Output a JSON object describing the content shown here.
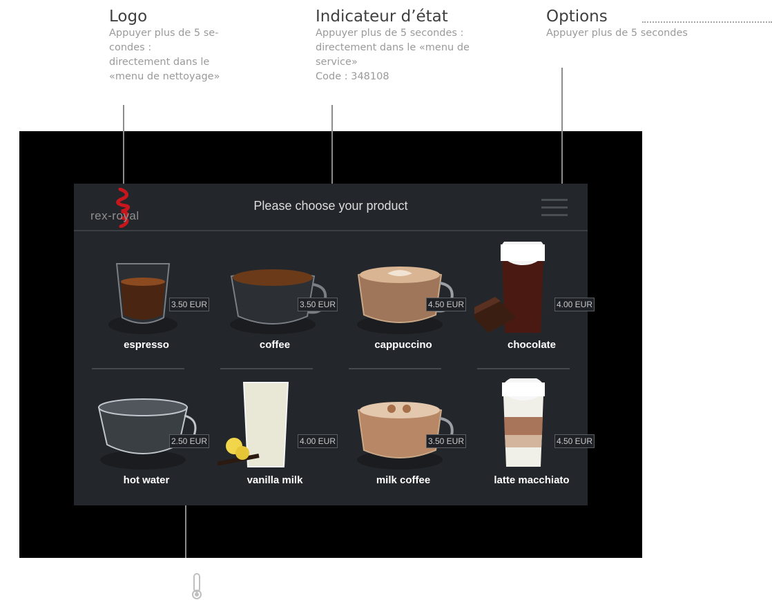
{
  "annotations": {
    "logo": {
      "title": "Logo",
      "body": "Appuyer plus de 5 se-\ncondes :\ndirectement dans le\n«menu de nettoyage»"
    },
    "status": {
      "title": "Indicateur d’état",
      "body": "Appuyer plus de 5 secondes :\ndirectement dans le «menu de\nservice»\nCode : 348108"
    },
    "options": {
      "title": "Options",
      "body": "Appuyer plus de 5 secondes"
    }
  },
  "header": {
    "logo_text": "rex-royal",
    "title": "Please choose your product",
    "menu_icon": "hamburger-menu-icon"
  },
  "products": [
    {
      "name": "espresso",
      "price": "3.50 EUR",
      "image": "espresso-cup-icon"
    },
    {
      "name": "coffee",
      "price": "3.50 EUR",
      "image": "coffee-cup-icon"
    },
    {
      "name": "cappuccino",
      "price": "4.50 EUR",
      "image": "cappuccino-cup-icon"
    },
    {
      "name": "chocolate",
      "price": "4.00 EUR",
      "image": "chocolate-glass-icon"
    },
    {
      "name": "hot water",
      "price": "2.50 EUR",
      "image": "hot-water-bowl-icon",
      "badge": "thermometer-icon"
    },
    {
      "name": "vanilla milk",
      "price": "4.00 EUR",
      "image": "vanilla-milk-glass-icon"
    },
    {
      "name": "milk coffee",
      "price": "3.50 EUR",
      "image": "milk-coffee-cup-icon"
    },
    {
      "name": "latte macchiato",
      "price": "4.50 EUR",
      "image": "latte-macchiato-glass-icon"
    }
  ],
  "colors": {
    "screen_bg": "#23272b",
    "bezel": "#000000",
    "logo_red": "#c8161d",
    "price_border": "#5b5f63"
  }
}
